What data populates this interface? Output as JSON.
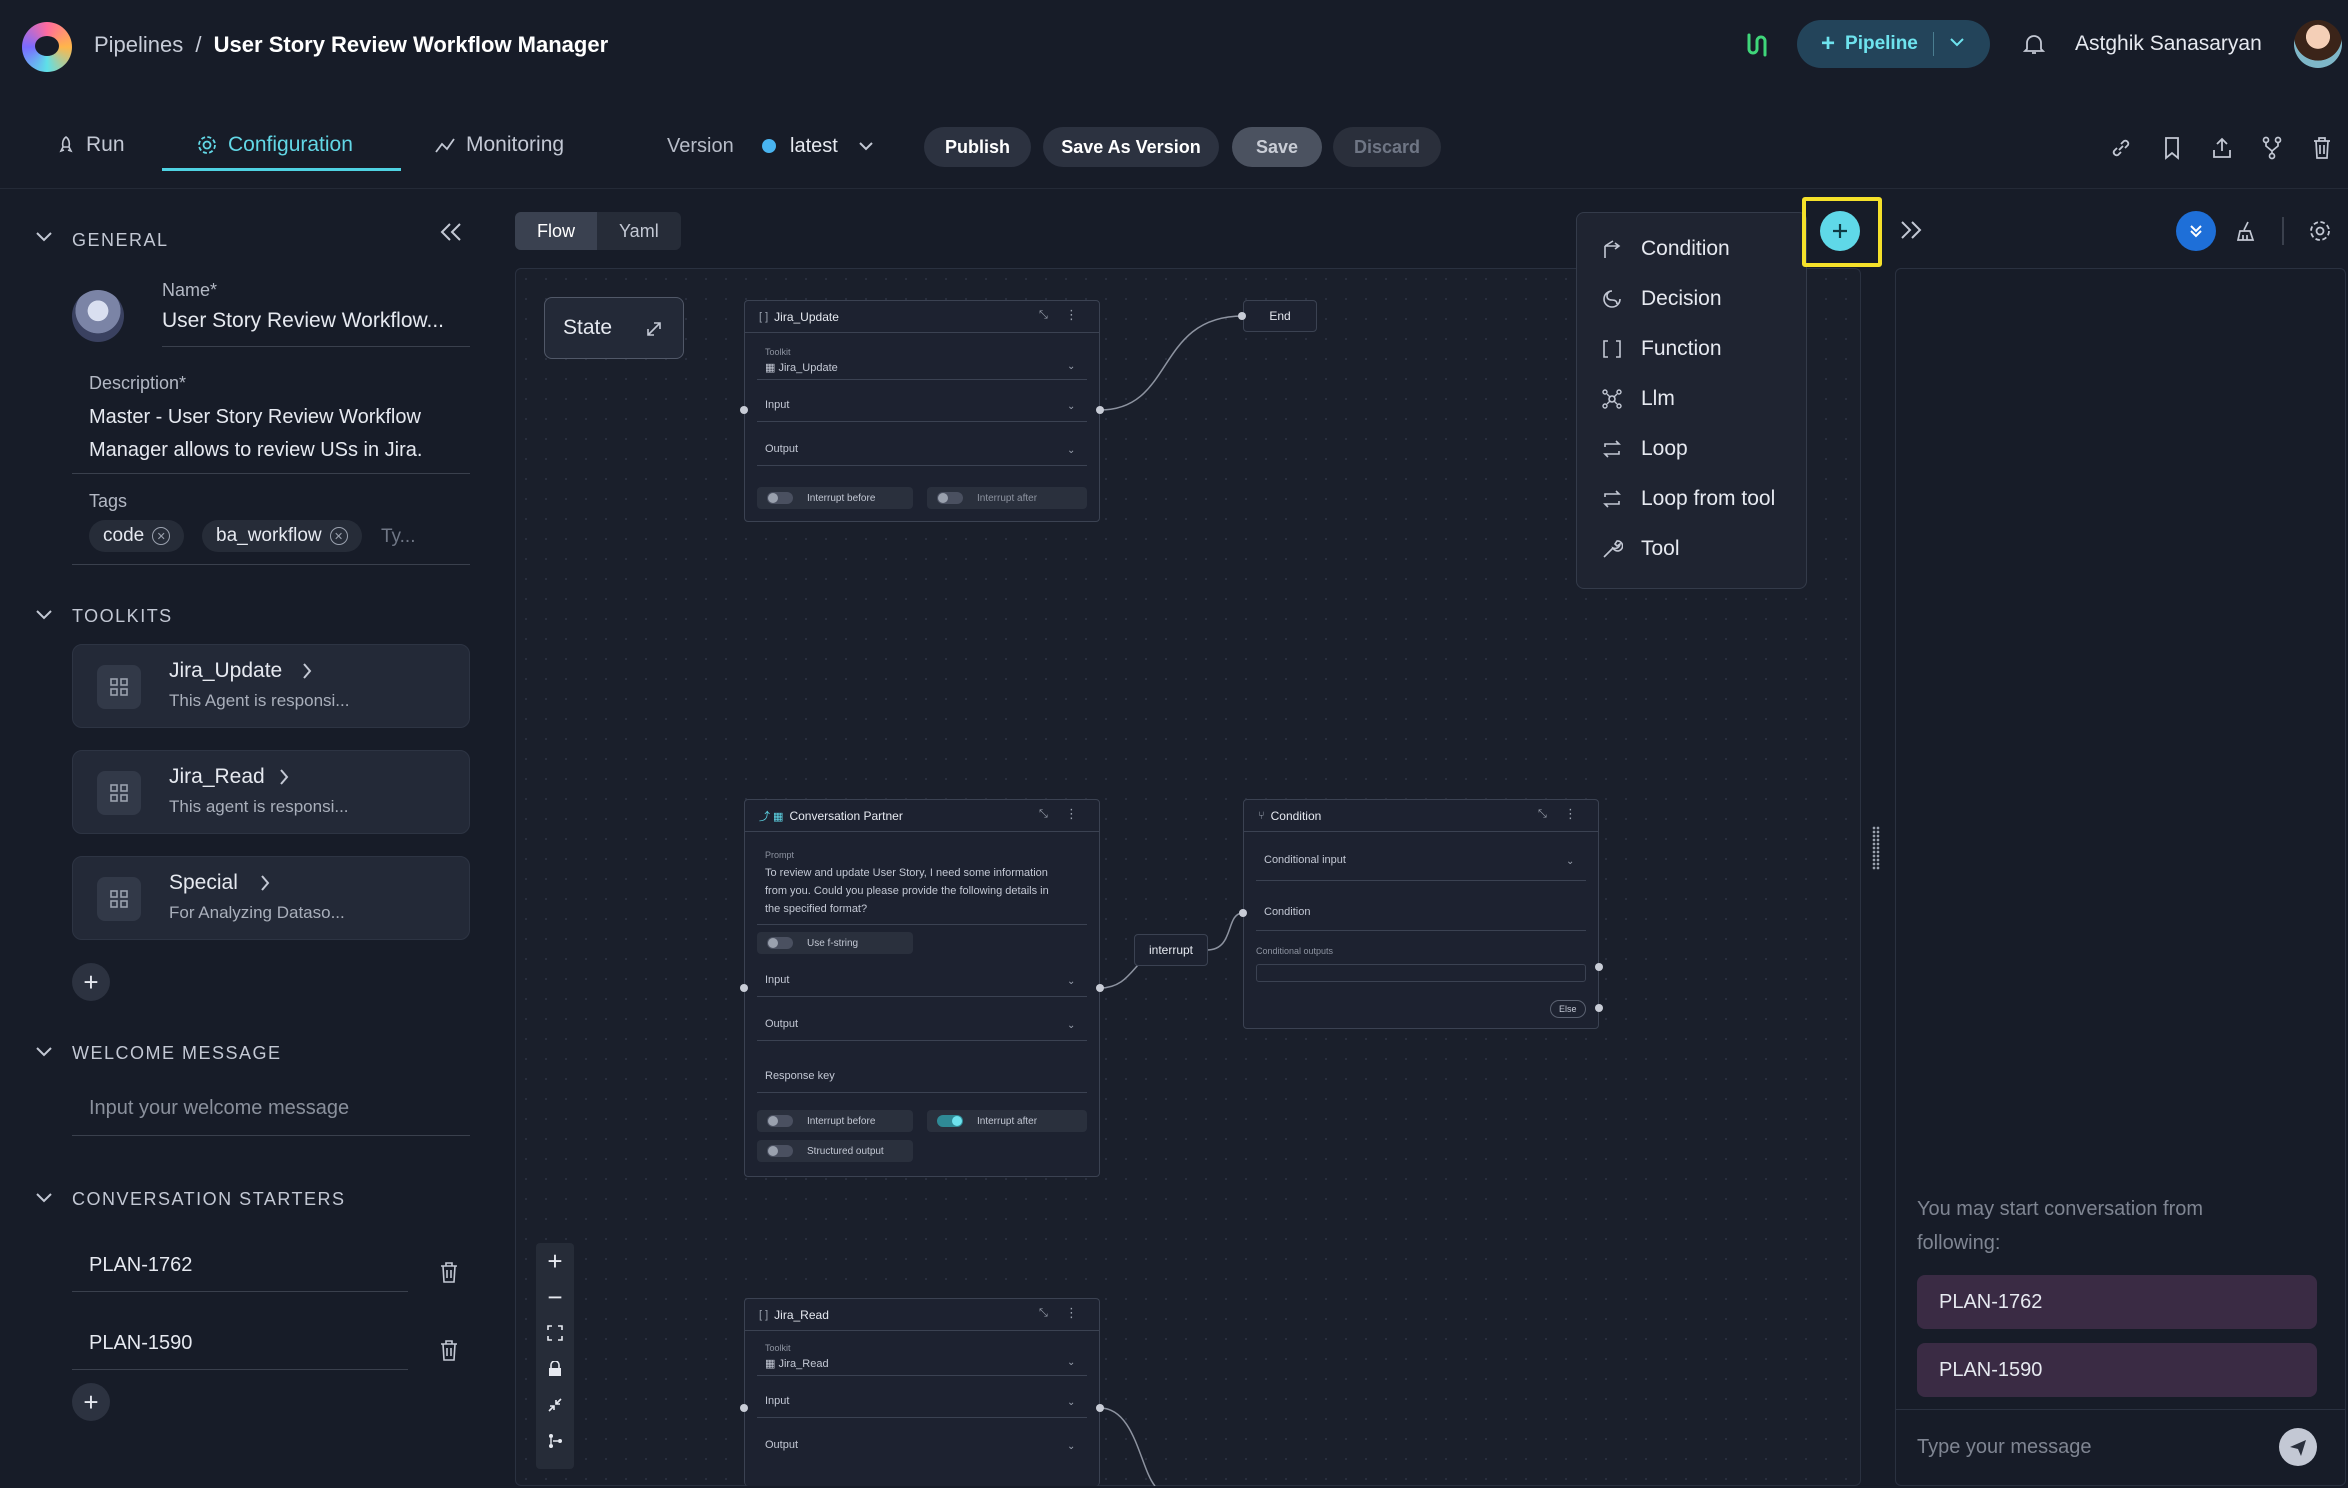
{
  "header": {
    "breadcrumb_root": "Pipelines",
    "breadcrumb_sep": "/",
    "breadcrumb_current": "User Story Review Workflow Manager",
    "create_button": "Pipeline",
    "user_name": "Astghik Sanasaryan"
  },
  "tabs": [
    {
      "label": "Run"
    },
    {
      "label": "Configuration",
      "active": true
    },
    {
      "label": "Monitoring"
    }
  ],
  "version": {
    "label": "Version",
    "value": "latest"
  },
  "actions": {
    "publish": "Publish",
    "save_as_version": "Save As Version",
    "save": "Save",
    "discard": "Discard"
  },
  "general": {
    "section_title": "GENERAL",
    "name_label": "Name*",
    "name_value": "User Story Review Workflow...",
    "description_label": "Description*",
    "description_line1": "Master - User Story Review Workflow",
    "description_line2": "Manager allows to review USs in Jira.",
    "tags_label": "Tags",
    "tags": [
      "code",
      "ba_workflow"
    ],
    "tags_placeholder": "Ty..."
  },
  "toolkits": {
    "section_title": "TOOLKITS",
    "items": [
      {
        "name": "Jira_Update",
        "desc": "This Agent is responsi..."
      },
      {
        "name": "Jira_Read",
        "desc": "This agent is responsi..."
      },
      {
        "name": "Special",
        "desc": "For Analyzing Dataso..."
      }
    ]
  },
  "welcome": {
    "section_title": "WELCOME MESSAGE",
    "placeholder": "Input your welcome message"
  },
  "starters": {
    "section_title": "CONVERSATION STARTERS",
    "items": [
      "PLAN-1762",
      "PLAN-1590"
    ]
  },
  "canvas": {
    "view_tabs": [
      "Flow",
      "Yaml"
    ],
    "state_label": "State",
    "end_label": "End",
    "interrupt_label": "interrupt",
    "node_jira_update": {
      "title": "Jira_Update",
      "toolkit_label": "Toolkit",
      "toolkit_value": "Jira_Update",
      "input": "Input",
      "output": "Output",
      "interrupt_before": "Interrupt before",
      "interrupt_after": "Interrupt after"
    },
    "node_conversation": {
      "title": "Conversation Partner",
      "prompt_label": "Prompt",
      "prompt_text_1": "To review and update User Story, I need some information",
      "prompt_text_2": "from you. Could you please provide the following details in",
      "prompt_text_3": "the specified format?",
      "use_fstring": "Use f-string",
      "input": "Input",
      "output": "Output",
      "response_key": "Response key",
      "interrupt_before": "Interrupt before",
      "interrupt_after": "Interrupt after",
      "structured_output": "Structured output"
    },
    "node_condition": {
      "title": "Condition",
      "conditional_input": "Conditional input",
      "condition": "Condition",
      "conditional_outputs": "Conditional outputs",
      "else": "Else"
    },
    "node_jira_read": {
      "title": "Jira_Read",
      "toolkit_label": "Toolkit",
      "toolkit_value": "Jira_Read",
      "input": "Input",
      "output": "Output"
    }
  },
  "add_menu": {
    "items": [
      {
        "label": "Condition",
        "icon": "condition-icon"
      },
      {
        "label": "Decision",
        "icon": "decision-icon"
      },
      {
        "label": "Function",
        "icon": "function-icon"
      },
      {
        "label": "Llm",
        "icon": "llm-icon"
      },
      {
        "label": "Loop",
        "icon": "loop-icon"
      },
      {
        "label": "Loop from tool",
        "icon": "loop-from-tool-icon"
      },
      {
        "label": "Tool",
        "icon": "tool-icon"
      }
    ]
  },
  "chat": {
    "hint_line1": "You may start conversation from",
    "hint_line2": "following:",
    "starters": [
      "PLAN-1762",
      "PLAN-1590"
    ],
    "input_placeholder": "Type your message"
  },
  "colors": {
    "accent": "#5fd8e8",
    "highlight": "#f5e12a",
    "background": "#171c28"
  }
}
